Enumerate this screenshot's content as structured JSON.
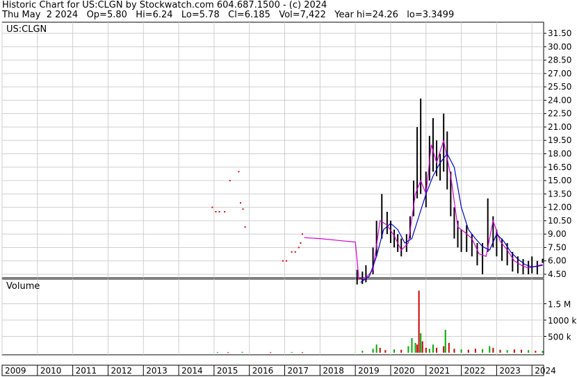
{
  "header": {
    "line1": "Historic Chart for US:CLGN by Stockwatch.com 604.687.1500 - (c) 2024",
    "line2": "Thu May  2 2024   Op=5.80   Hi=6.24   Lo=5.78   Cl=6.185   Vol=7,422   Year hi=24.26   lo=3.3499"
  },
  "colors": {
    "price_bar": "#000000",
    "price_dot": "#dd0000",
    "ma_short": "#d400d4",
    "ma_long": "#0000cc",
    "vol_up": "#00aa00",
    "vol_down": "#cc0000",
    "grid": "#cfcfcf",
    "frame": "#000000"
  },
  "chart_data": [
    {
      "type": "line",
      "title": "US:CLGN",
      "xlabel": "",
      "ylabel": "",
      "y_ticks": [
        "31.50",
        "30.00",
        "28.50",
        "27.00",
        "25.50",
        "24.00",
        "22.50",
        "21.00",
        "19.50",
        "18.00",
        "16.50",
        "15.00",
        "13.50",
        "12.00",
        "10.50",
        "9.00",
        "7.50",
        "6.00",
        "4.50"
      ],
      "ylim": [
        3.0,
        32.5
      ],
      "x_ticks": [
        "2009",
        "2010",
        "2011",
        "2012",
        "2013",
        "2014",
        "2015",
        "2016",
        "2017",
        "2018",
        "2019",
        "2020",
        "2021",
        "2022",
        "2023",
        "2024"
      ],
      "grid": true,
      "series": [
        {
          "role": "price_high_low",
          "x": [
            2019.05,
            2019.2,
            2019.3,
            2019.5,
            2019.6,
            2019.75,
            2019.9,
            2020.0,
            2020.1,
            2020.2,
            2020.3,
            2020.45,
            2020.55,
            2020.65,
            2020.75,
            2020.85,
            2021.0,
            2021.1,
            2021.2,
            2021.3,
            2021.4,
            2021.5,
            2021.6,
            2021.7,
            2021.8,
            2021.9,
            2022.0,
            2022.15,
            2022.3,
            2022.45,
            2022.6,
            2022.75,
            2022.9,
            2023.0,
            2023.15,
            2023.3,
            2023.45,
            2023.6,
            2023.75,
            2023.9,
            2024.0,
            2024.15,
            2024.3
          ],
          "high": [
            5.0,
            4.8,
            5.5,
            7.5,
            10.5,
            13.5,
            11.5,
            10.5,
            9.5,
            9.0,
            8.5,
            9.0,
            11.0,
            15.0,
            21.0,
            24.2,
            16.0,
            20.0,
            22.0,
            19.5,
            18.0,
            22.5,
            20.5,
            16.0,
            12.0,
            10.5,
            9.5,
            10.0,
            9.0,
            8.0,
            8.0,
            13.0,
            11.0,
            9.5,
            8.5,
            8.0,
            7.0,
            6.5,
            6.2,
            6.0,
            6.5,
            6.0,
            6.24
          ],
          "low": [
            3.35,
            3.4,
            3.6,
            4.5,
            6.5,
            8.5,
            9.0,
            8.0,
            7.5,
            7.0,
            6.5,
            7.0,
            8.5,
            11.0,
            13.0,
            13.5,
            12.0,
            15.0,
            16.0,
            15.5,
            15.0,
            16.0,
            14.0,
            11.0,
            8.5,
            7.5,
            7.0,
            7.0,
            6.5,
            5.5,
            4.5,
            7.0,
            7.5,
            6.5,
            6.0,
            5.5,
            4.8,
            4.6,
            4.5,
            4.5,
            4.6,
            4.5,
            5.78
          ]
        },
        {
          "role": "price_early_dots",
          "x": [
            2014.95,
            2015.05,
            2015.15,
            2015.3,
            2015.45,
            2015.7,
            2015.75,
            2015.82,
            2015.88,
            2016.95,
            2017.05,
            2017.2,
            2017.3,
            2017.4,
            2017.45,
            2017.5
          ],
          "y": [
            12.0,
            11.5,
            11.5,
            11.5,
            15.0,
            16.0,
            12.5,
            11.8,
            9.8,
            6.0,
            6.0,
            7.0,
            7.0,
            7.5,
            8.0,
            9.0
          ]
        },
        {
          "name": "",
          "role": "ma_short",
          "x": [
            2017.55,
            2018.0,
            2018.5,
            2019.0,
            2019.1,
            2019.3,
            2019.5,
            2019.7,
            2019.9,
            2020.1,
            2020.3,
            2020.5,
            2020.7,
            2020.85,
            2021.0,
            2021.15,
            2021.3,
            2021.5,
            2021.7,
            2021.9,
            2022.1,
            2022.3,
            2022.5,
            2022.7,
            2022.9,
            2023.1,
            2023.3,
            2023.5,
            2023.7,
            2023.9,
            2024.1,
            2024.3
          ],
          "y": [
            8.6,
            8.5,
            8.3,
            8.1,
            4.0,
            4.1,
            5.0,
            10.5,
            10.0,
            8.8,
            7.2,
            8.0,
            13.5,
            15.0,
            13.5,
            19.0,
            17.0,
            19.5,
            15.5,
            9.8,
            9.2,
            8.5,
            6.8,
            6.5,
            10.5,
            8.2,
            7.2,
            6.0,
            5.5,
            5.2,
            5.4,
            5.6
          ]
        },
        {
          "name": "",
          "role": "ma_long",
          "x": [
            2019.15,
            2019.4,
            2019.6,
            2019.8,
            2020.0,
            2020.2,
            2020.4,
            2020.6,
            2020.8,
            2021.0,
            2021.2,
            2021.4,
            2021.6,
            2021.8,
            2022.0,
            2022.2,
            2022.4,
            2022.6,
            2022.8,
            2023.0,
            2023.2,
            2023.4,
            2023.6,
            2023.8,
            2024.0,
            2024.3
          ],
          "y": [
            3.6,
            4.3,
            6.5,
            9.5,
            10.2,
            9.5,
            8.0,
            8.5,
            11.0,
            13.5,
            15.5,
            17.0,
            18.0,
            16.5,
            12.0,
            9.5,
            8.5,
            7.6,
            7.2,
            9.0,
            8.2,
            7.0,
            6.2,
            5.6,
            5.3,
            5.5
          ]
        }
      ]
    },
    {
      "type": "bar",
      "title": "Volume",
      "y_ticks": [
        "1.5 M",
        "1000 k",
        "500 k"
      ],
      "ylim": [
        0,
        2000000
      ],
      "series": [
        {
          "name": "",
          "role": "volume",
          "x": [
            2015.1,
            2015.4,
            2015.8,
            2016.6,
            2017.2,
            2017.5,
            2019.2,
            2019.5,
            2019.6,
            2019.7,
            2019.85,
            2020.1,
            2020.3,
            2020.5,
            2020.6,
            2020.7,
            2020.75,
            2020.8,
            2020.85,
            2020.9,
            2021.0,
            2021.1,
            2021.2,
            2021.3,
            2021.5,
            2021.55,
            2021.65,
            2021.8,
            2022.0,
            2022.2,
            2022.4,
            2022.6,
            2022.8,
            2022.9,
            2023.1,
            2023.3,
            2023.5,
            2023.7,
            2023.9,
            2024.1,
            2024.3
          ],
          "values": [
            20000,
            15000,
            25000,
            15000,
            20000,
            15000,
            60000,
            120000,
            250000,
            150000,
            80000,
            100000,
            90000,
            200000,
            450000,
            300000,
            250000,
            1900000,
            600000,
            350000,
            150000,
            120000,
            250000,
            150000,
            200000,
            700000,
            300000,
            120000,
            100000,
            90000,
            120000,
            110000,
            200000,
            150000,
            90000,
            80000,
            100000,
            90000,
            80000,
            60000,
            50000
          ],
          "up": [
            true,
            false,
            true,
            false,
            true,
            false,
            true,
            true,
            true,
            false,
            false,
            true,
            false,
            true,
            true,
            true,
            false,
            false,
            true,
            false,
            false,
            true,
            true,
            false,
            false,
            true,
            false,
            false,
            true,
            false,
            false,
            true,
            true,
            false,
            false,
            true,
            false,
            false,
            true,
            false,
            true
          ]
        }
      ]
    }
  ]
}
